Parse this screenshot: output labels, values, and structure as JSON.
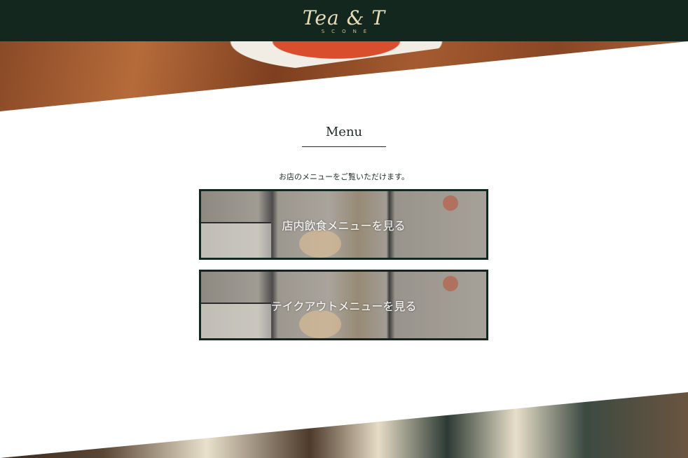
{
  "header": {
    "logo_text": "Tea & T",
    "logo_subtext": "SCONE"
  },
  "menu": {
    "title": "Menu",
    "intro": "お店のメニューをご覧いただけます。",
    "cards": [
      {
        "label": "店内飲食メニューを見る"
      },
      {
        "label": "テイクアウトメニューを見る"
      }
    ]
  },
  "colors": {
    "header_bg": "#13271f",
    "logo_gold": "#e7ddb8",
    "card_border": "#13271f"
  }
}
